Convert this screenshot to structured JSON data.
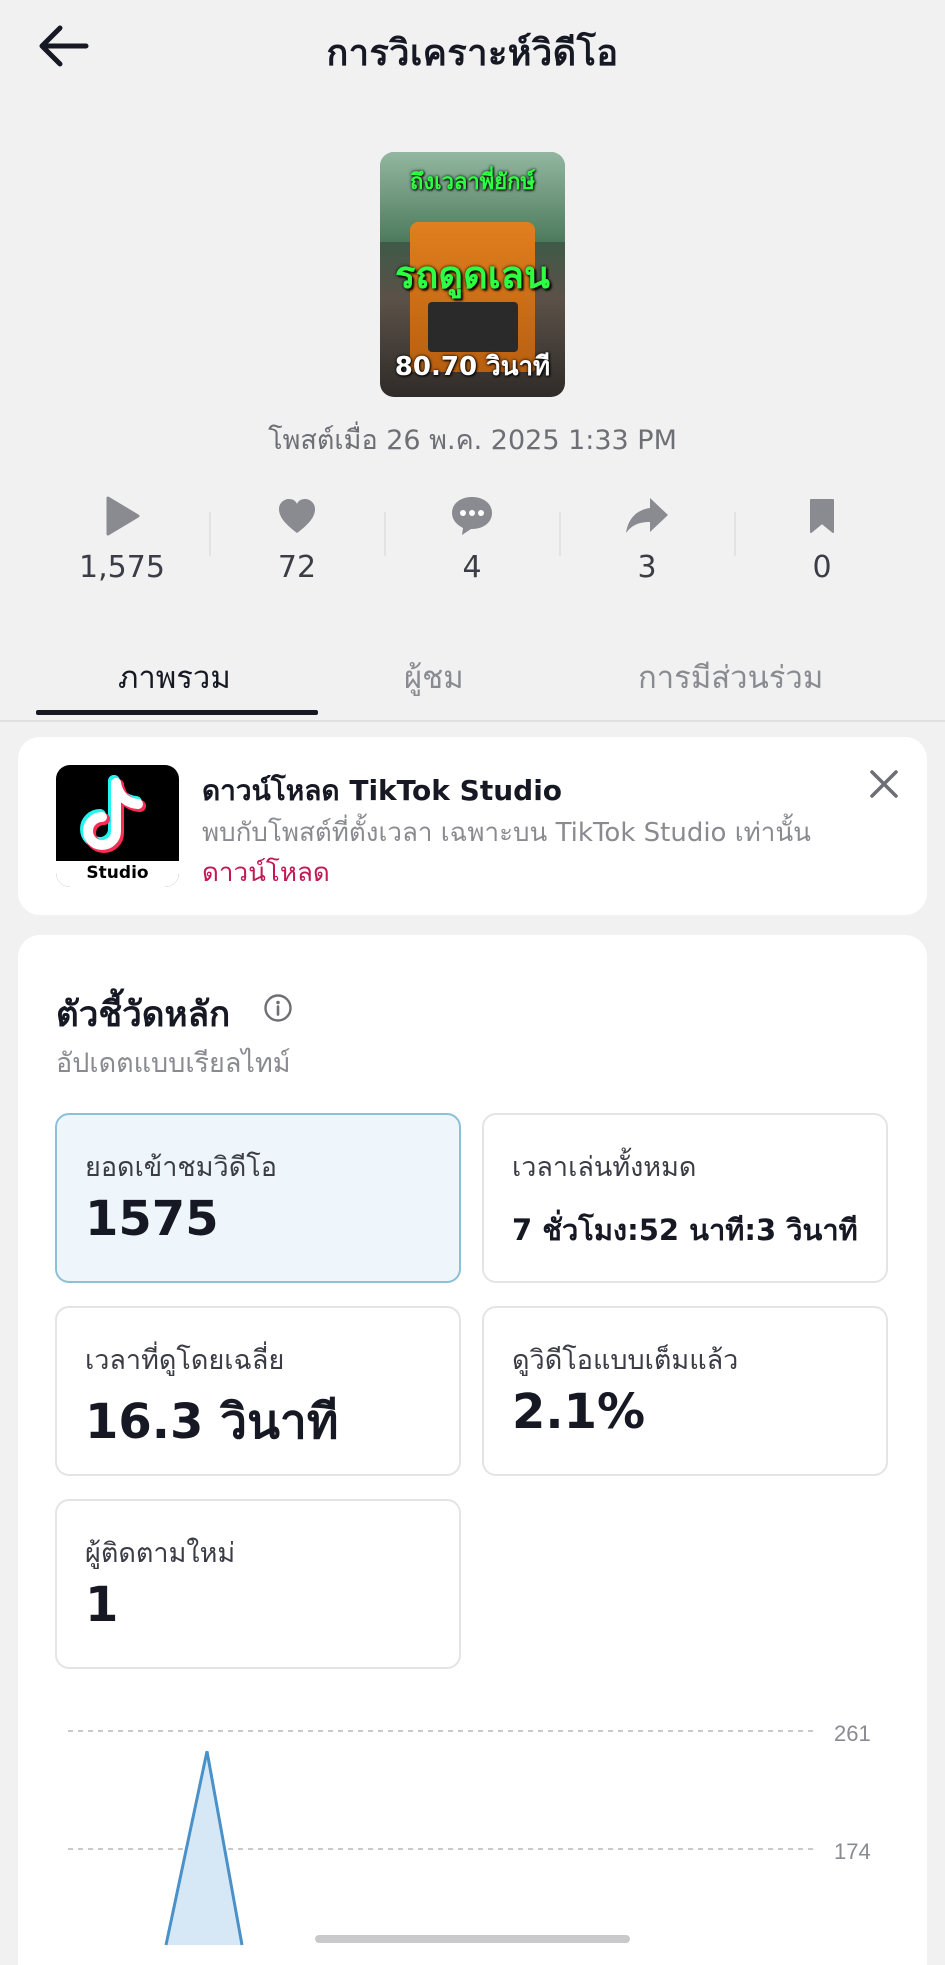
{
  "header": {
    "title": "การวิเคราะห์วิดีโอ",
    "back_icon": "arrow-left-icon"
  },
  "video": {
    "thumbnail_top_text": "ถึงเวลาพี่ยักษ์",
    "thumbnail_main_text": "รถดูดเลน",
    "thumbnail_duration_text": "80.70 วินาที",
    "posted_text": "โพสต์เมื่อ 26 พ.ค. 2025 1:33 PM"
  },
  "stats": [
    {
      "icon": "play-icon",
      "value": "1,575"
    },
    {
      "icon": "heart-icon",
      "value": "72"
    },
    {
      "icon": "comment-icon",
      "value": "4"
    },
    {
      "icon": "share-icon",
      "value": "3"
    },
    {
      "icon": "bookmark-icon",
      "value": "0"
    }
  ],
  "tabs": [
    {
      "label": "ภาพรวม",
      "active": true
    },
    {
      "label": "ผู้ชม",
      "active": false
    },
    {
      "label": "การมีส่วนร่วม",
      "active": false
    }
  ],
  "promo": {
    "app_icon_label": "Studio",
    "title": "ดาวน์โหลด TikTok Studio",
    "description": "พบกับโพสต์ที่ตั้งเวลา เฉพาะบน TikTok Studio เท่านั้น",
    "link_text": "ดาวน์โหลด"
  },
  "metrics": {
    "title": "ตัวชี้วัดหลัก",
    "subtitle": "อัปเดตแบบเรียลไทม์",
    "cards": [
      {
        "label": "ยอดเข้าชมวิดีโอ",
        "value": "1575",
        "selected": true
      },
      {
        "label": "เวลาเล่นทั้งหมด",
        "value": "7 ชั่วโมง:52 นาที:3 วินาที",
        "selected": false
      },
      {
        "label": "เวลาที่ดูโดยเฉลี่ย",
        "value": "16.3 วินาที",
        "selected": false
      },
      {
        "label": "ดูวิดีโอแบบเต็มแล้ว",
        "value": "2.1%",
        "selected": false
      },
      {
        "label": "ผู้ติดตามใหม่",
        "value": "1",
        "selected": false
      }
    ]
  },
  "chart_data": {
    "type": "area",
    "y_ticks": [
      "261",
      "174"
    ],
    "ylim": [
      0,
      261
    ],
    "peak_value": 246,
    "color": "#4a90c9",
    "fill": "#d6e8f6"
  },
  "colors": {
    "accent_link": "#c21854",
    "text_primary": "#161823",
    "text_secondary": "#8a8b91"
  }
}
